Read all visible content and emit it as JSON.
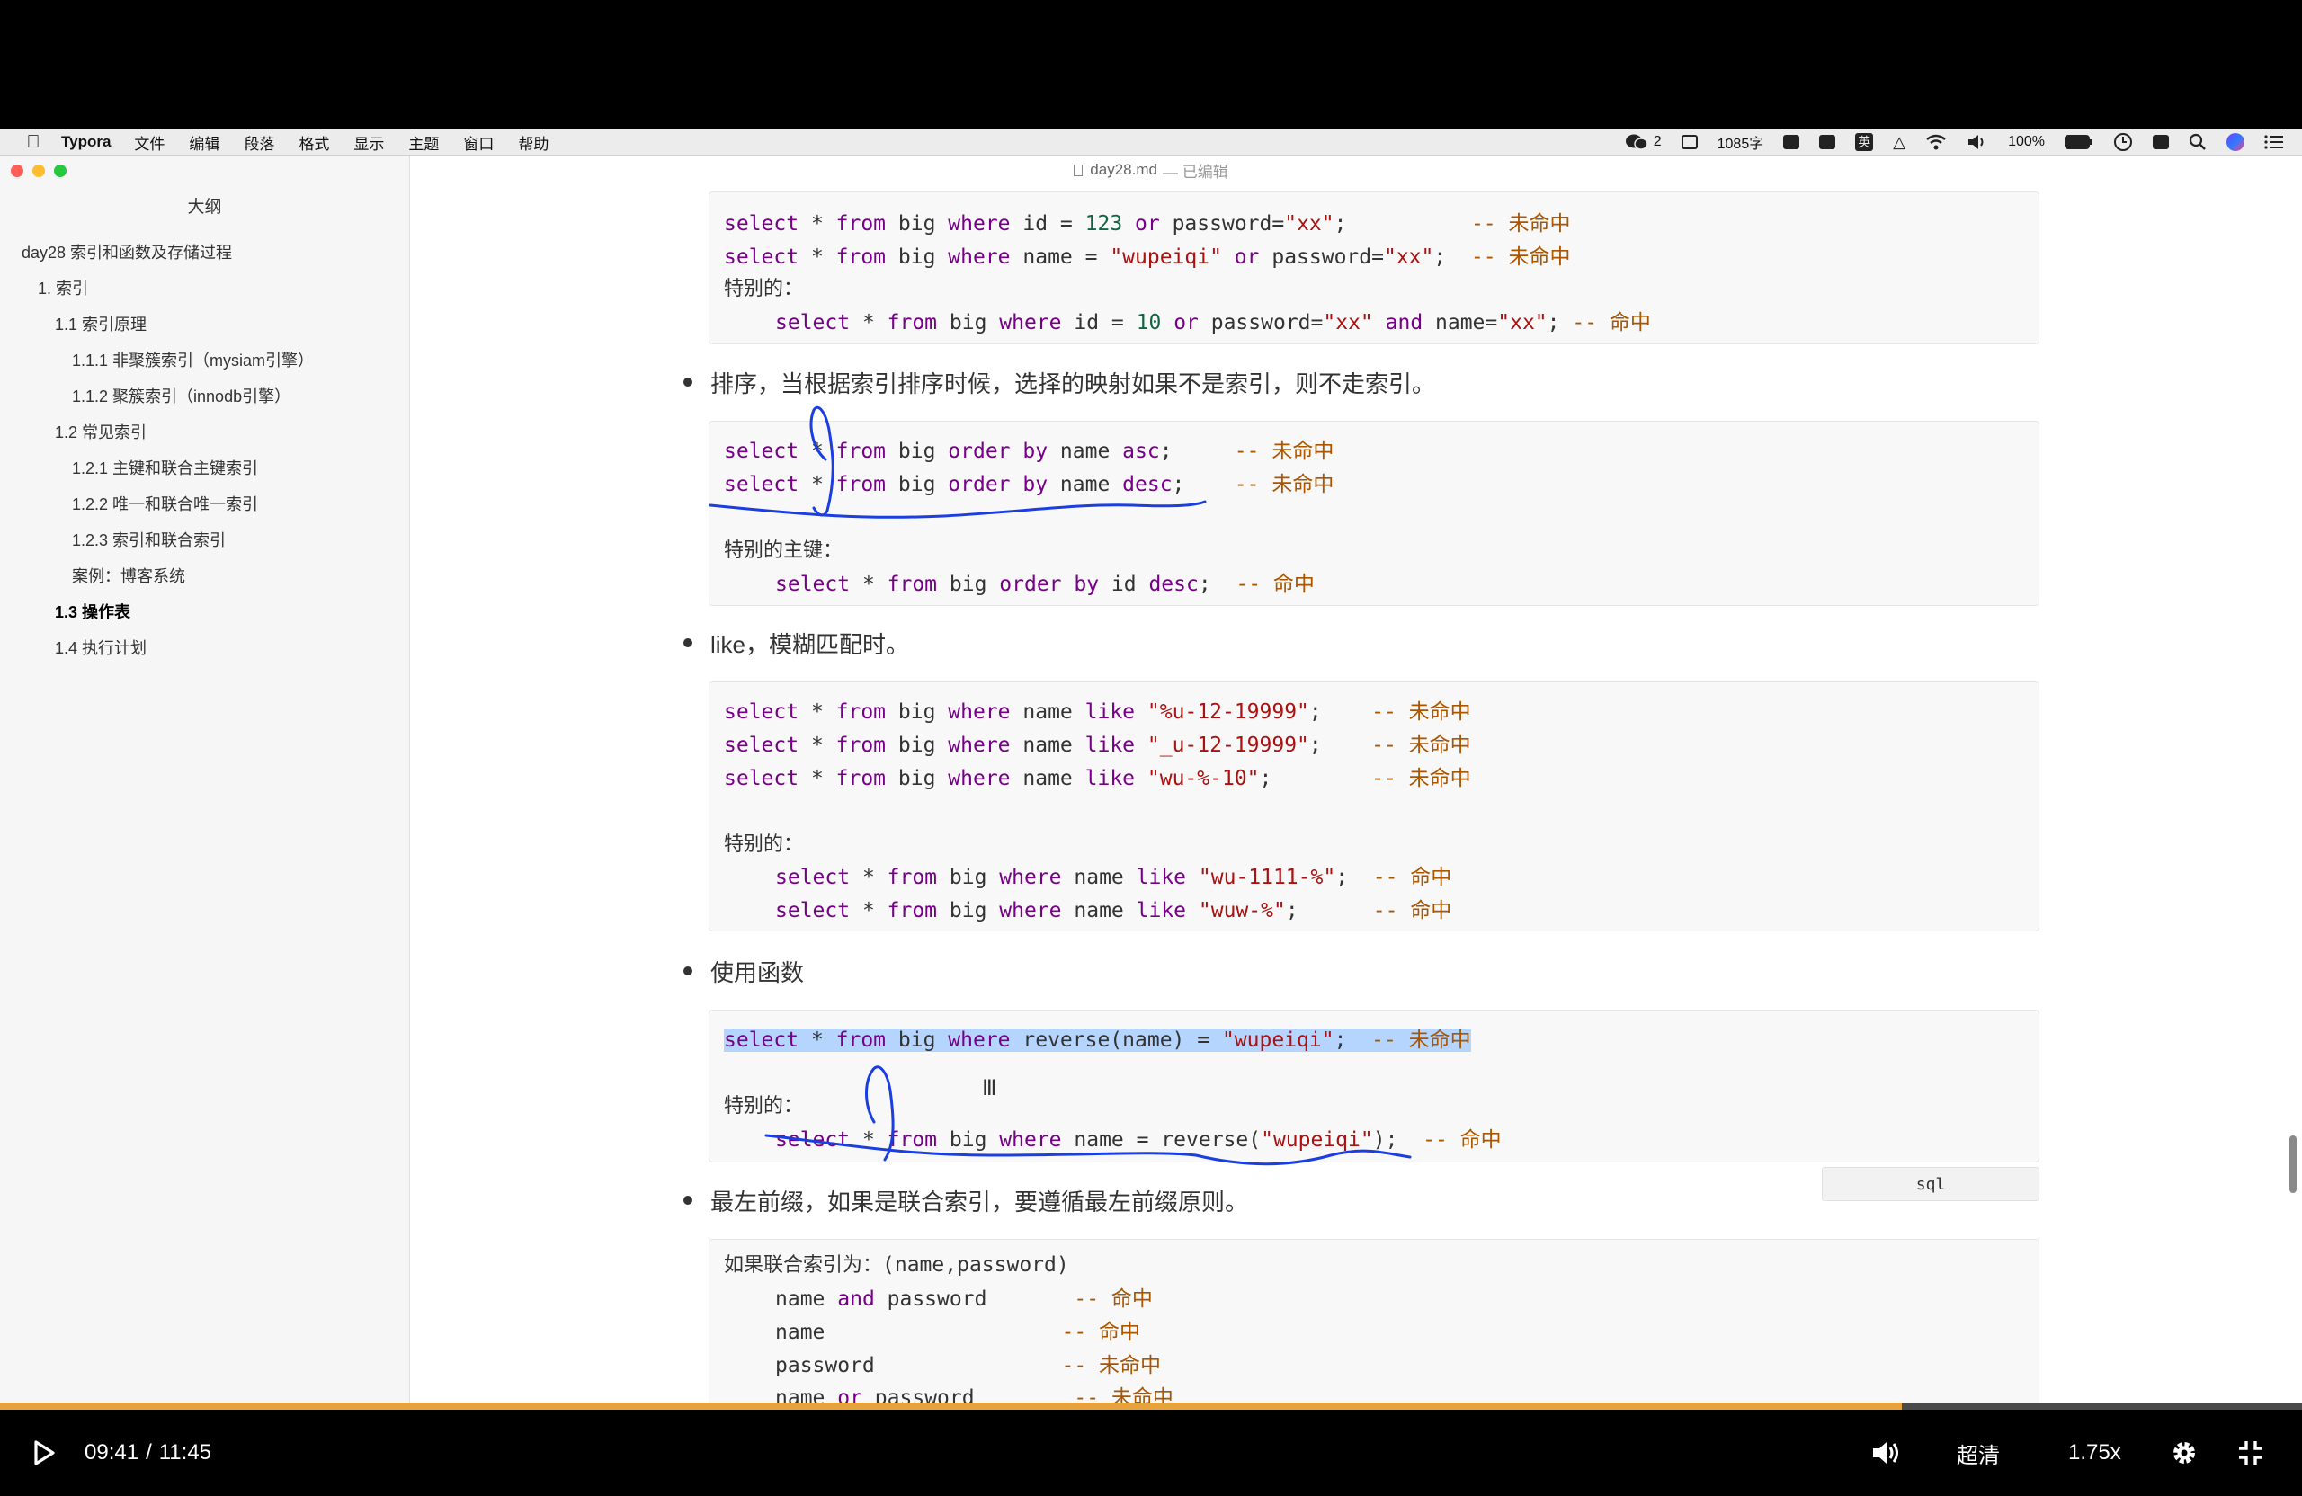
{
  "menubar": {
    "items": [
      "Typora",
      "文件",
      "编辑",
      "段落",
      "格式",
      "显示",
      "主题",
      "窗口",
      "帮助"
    ],
    "status": {
      "wechat_count": "2",
      "word_count": "1085字",
      "battery": "100%",
      "ime_label": "英"
    }
  },
  "window": {
    "title": "day28.md",
    "edit_state": "— 已编辑"
  },
  "sidebar": {
    "title": "大纲",
    "items": [
      {
        "label": "day28 索引和函数及存储过程",
        "level": 1
      },
      {
        "label": "1. 索引",
        "level": 2
      },
      {
        "label": "1.1 索引原理",
        "level": 3
      },
      {
        "label": "1.1.1 非聚簇索引（mysiam引擎）",
        "level": 4
      },
      {
        "label": "1.1.2 聚簇索引（innodb引擎）",
        "level": 4
      },
      {
        "label": "1.2 常见索引",
        "level": 3
      },
      {
        "label": "1.2.1 主键和联合主键索引",
        "level": 4
      },
      {
        "label": "1.2.2 唯一和联合唯一索引",
        "level": 4
      },
      {
        "label": "1.2.3 索引和联合索引",
        "level": 4
      },
      {
        "label": "案例：博客系统",
        "level": 4
      },
      {
        "label": "1.3 操作表",
        "level": 3,
        "active": true
      },
      {
        "label": "1.4 执行计划",
        "level": 3
      }
    ]
  },
  "doc": {
    "bullets": [
      "排序，当根据索引排序时候，选择的映射如果不是索引，则不走索引。",
      "like，模糊匹配时。",
      "使用函数",
      "最左前缀，如果是联合索引，要遵循最左前缀原则。"
    ],
    "code_lang": "sql",
    "code1": [
      {
        "indent": false,
        "parts": [
          [
            "k",
            "select"
          ],
          [
            "t",
            " * "
          ],
          [
            "k",
            "from"
          ],
          [
            "t",
            " big "
          ],
          [
            "k",
            "where"
          ],
          [
            "t",
            " id = "
          ],
          [
            "n",
            "123"
          ],
          [
            "t",
            " "
          ],
          [
            "k",
            "or"
          ],
          [
            "t",
            " password="
          ],
          [
            "s",
            "\"xx\""
          ],
          [
            "t",
            ";          "
          ],
          [
            "c",
            "-- 未命中"
          ]
        ]
      },
      {
        "indent": false,
        "parts": [
          [
            "k",
            "select"
          ],
          [
            "t",
            " * "
          ],
          [
            "k",
            "from"
          ],
          [
            "t",
            " big "
          ],
          [
            "k",
            "where"
          ],
          [
            "t",
            " name = "
          ],
          [
            "s",
            "\"wupeiqi\""
          ],
          [
            "t",
            " "
          ],
          [
            "k",
            "or"
          ],
          [
            "t",
            " password="
          ],
          [
            "s",
            "\"xx\""
          ],
          [
            "t",
            ";  "
          ],
          [
            "c",
            "-- 未命中"
          ]
        ]
      },
      {
        "indent": false,
        "parts": [
          [
            "p",
            "特别的："
          ]
        ]
      },
      {
        "indent": true,
        "parts": [
          [
            "k",
            "select"
          ],
          [
            "t",
            " * "
          ],
          [
            "k",
            "from"
          ],
          [
            "t",
            " big "
          ],
          [
            "k",
            "where"
          ],
          [
            "t",
            " id = "
          ],
          [
            "n",
            "10"
          ],
          [
            "t",
            " "
          ],
          [
            "k",
            "or"
          ],
          [
            "t",
            " password="
          ],
          [
            "s",
            "\"xx\""
          ],
          [
            "t",
            " "
          ],
          [
            "k",
            "and"
          ],
          [
            "t",
            " name="
          ],
          [
            "s",
            "\"xx\""
          ],
          [
            "t",
            "; "
          ],
          [
            "c",
            "-- 命中"
          ]
        ]
      }
    ],
    "code2": [
      {
        "indent": false,
        "parts": [
          [
            "k",
            "select"
          ],
          [
            "t",
            " * "
          ],
          [
            "k",
            "from"
          ],
          [
            "t",
            " big "
          ],
          [
            "k",
            "order by"
          ],
          [
            "t",
            " name "
          ],
          [
            "k",
            "asc"
          ],
          [
            "t",
            ";     "
          ],
          [
            "c",
            "-- 未命中"
          ]
        ]
      },
      {
        "indent": false,
        "parts": [
          [
            "k",
            "select"
          ],
          [
            "t",
            " * "
          ],
          [
            "k",
            "from"
          ],
          [
            "t",
            " big "
          ],
          [
            "k",
            "order by"
          ],
          [
            "t",
            " name "
          ],
          [
            "k",
            "desc"
          ],
          [
            "t",
            ";    "
          ],
          [
            "c",
            "-- 未命中"
          ]
        ]
      },
      {
        "indent": false,
        "parts": [
          [
            "p",
            "特别的主键："
          ]
        ]
      },
      {
        "indent": true,
        "parts": [
          [
            "k",
            "select"
          ],
          [
            "t",
            " * "
          ],
          [
            "k",
            "from"
          ],
          [
            "t",
            " big "
          ],
          [
            "k",
            "order by"
          ],
          [
            "t",
            " id "
          ],
          [
            "k",
            "desc"
          ],
          [
            "t",
            ";  "
          ],
          [
            "c",
            "-- 命中"
          ]
        ]
      }
    ],
    "code3": [
      {
        "indent": false,
        "parts": [
          [
            "k",
            "select"
          ],
          [
            "t",
            " * "
          ],
          [
            "k",
            "from"
          ],
          [
            "t",
            " big "
          ],
          [
            "k",
            "where"
          ],
          [
            "t",
            " name "
          ],
          [
            "k",
            "like"
          ],
          [
            "t",
            " "
          ],
          [
            "s",
            "\"%u-12-19999\""
          ],
          [
            "t",
            ";    "
          ],
          [
            "c",
            "-- 未命中"
          ]
        ]
      },
      {
        "indent": false,
        "parts": [
          [
            "k",
            "select"
          ],
          [
            "t",
            " * "
          ],
          [
            "k",
            "from"
          ],
          [
            "t",
            " big "
          ],
          [
            "k",
            "where"
          ],
          [
            "t",
            " name "
          ],
          [
            "k",
            "like"
          ],
          [
            "t",
            " "
          ],
          [
            "s",
            "\"_u-12-19999\""
          ],
          [
            "t",
            ";    "
          ],
          [
            "c",
            "-- 未命中"
          ]
        ]
      },
      {
        "indent": false,
        "parts": [
          [
            "k",
            "select"
          ],
          [
            "t",
            " * "
          ],
          [
            "k",
            "from"
          ],
          [
            "t",
            " big "
          ],
          [
            "k",
            "where"
          ],
          [
            "t",
            " name "
          ],
          [
            "k",
            "like"
          ],
          [
            "t",
            " "
          ],
          [
            "s",
            "\"wu-%-10\""
          ],
          [
            "t",
            ";        "
          ],
          [
            "c",
            "-- 未命中"
          ]
        ]
      },
      {
        "indent": false,
        "parts": [
          [
            "p",
            "特别的："
          ]
        ]
      },
      {
        "indent": true,
        "parts": [
          [
            "k",
            "select"
          ],
          [
            "t",
            " * "
          ],
          [
            "k",
            "from"
          ],
          [
            "t",
            " big "
          ],
          [
            "k",
            "where"
          ],
          [
            "t",
            " name "
          ],
          [
            "k",
            "like"
          ],
          [
            "t",
            " "
          ],
          [
            "s",
            "\"wu-1111-%\""
          ],
          [
            "t",
            ";  "
          ],
          [
            "c",
            "-- 命中"
          ]
        ]
      },
      {
        "indent": true,
        "parts": [
          [
            "k",
            "select"
          ],
          [
            "t",
            " * "
          ],
          [
            "k",
            "from"
          ],
          [
            "t",
            " big "
          ],
          [
            "k",
            "where"
          ],
          [
            "t",
            " name "
          ],
          [
            "k",
            "like"
          ],
          [
            "t",
            " "
          ],
          [
            "s",
            "\"wuw-%\""
          ],
          [
            "t",
            ";      "
          ],
          [
            "c",
            "-- 命中"
          ]
        ]
      }
    ],
    "code4": [
      {
        "indent": false,
        "highlight": true,
        "parts": [
          [
            "k",
            "select"
          ],
          [
            "t",
            " * "
          ],
          [
            "k",
            "from"
          ],
          [
            "t",
            " big "
          ],
          [
            "k",
            "where"
          ],
          [
            "t",
            " reverse(name) = "
          ],
          [
            "s",
            "\"wupeiqi\""
          ],
          [
            "t",
            ";  "
          ],
          [
            "c",
            "-- 未命中"
          ]
        ]
      },
      {
        "indent": false,
        "parts": [
          [
            "p",
            "特别的："
          ]
        ]
      },
      {
        "indent": true,
        "parts": [
          [
            "k",
            "select"
          ],
          [
            "t",
            " * "
          ],
          [
            "k",
            "from"
          ],
          [
            "t",
            " big "
          ],
          [
            "k",
            "where"
          ],
          [
            "t",
            " name = reverse("
          ],
          [
            "s",
            "\"wupeiqi\""
          ],
          [
            "t",
            ");  "
          ],
          [
            "c",
            "-- 命中"
          ]
        ]
      }
    ],
    "code5": [
      {
        "indent": false,
        "parts": [
          [
            "p",
            "如果联合索引为："
          ],
          [
            "t",
            "(name,password)"
          ]
        ]
      },
      {
        "indent": true,
        "parts": [
          [
            "t",
            "name "
          ],
          [
            "k",
            "and"
          ],
          [
            "t",
            " password       "
          ],
          [
            "c",
            "-- 命中"
          ]
        ]
      },
      {
        "indent": true,
        "parts": [
          [
            "t",
            "name                   "
          ],
          [
            "c",
            "-- 命中"
          ]
        ]
      },
      {
        "indent": true,
        "parts": [
          [
            "t",
            "password               "
          ],
          [
            "c",
            "-- 未命中"
          ]
        ]
      },
      {
        "indent": true,
        "parts": [
          [
            "t",
            "name "
          ],
          [
            "k",
            "or"
          ],
          [
            "t",
            " password        "
          ],
          [
            "c",
            "-- 未命中"
          ]
        ]
      }
    ]
  },
  "player": {
    "current_time": "09:41",
    "total_time": "11:45",
    "time_sep": "/",
    "progress": 0.826,
    "quality": "超清",
    "speed": "1.75x",
    "annotation_color": "#1a3ee0"
  }
}
